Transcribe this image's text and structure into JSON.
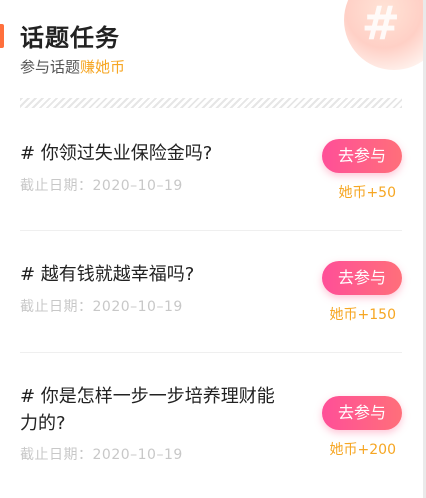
{
  "header": {
    "title": "话题任务",
    "subtitle_prefix": "参与话题",
    "subtitle_highlight": "赚她币"
  },
  "deco": {
    "glyph": "#"
  },
  "colors": {
    "accent_bar": "#ff6f3c",
    "highlight": "#f6a623",
    "button_gradient_start": "#ff4f98",
    "button_gradient_end": "#ff6f7a"
  },
  "topics": [
    {
      "title": "# 你领过失业保险金吗?",
      "deadline": "截止日期：2020–10–19",
      "button_label": "去参与",
      "reward": "她币+50"
    },
    {
      "title": "# 越有钱就越幸福吗?",
      "deadline": "截止日期：2020–10–19",
      "button_label": "去参与",
      "reward": "她币+150"
    },
    {
      "title": "# 你是怎样一步一步培养理财能力的?",
      "deadline": "截止日期：2020–10–19",
      "button_label": "去参与",
      "reward": "她币+200"
    }
  ]
}
